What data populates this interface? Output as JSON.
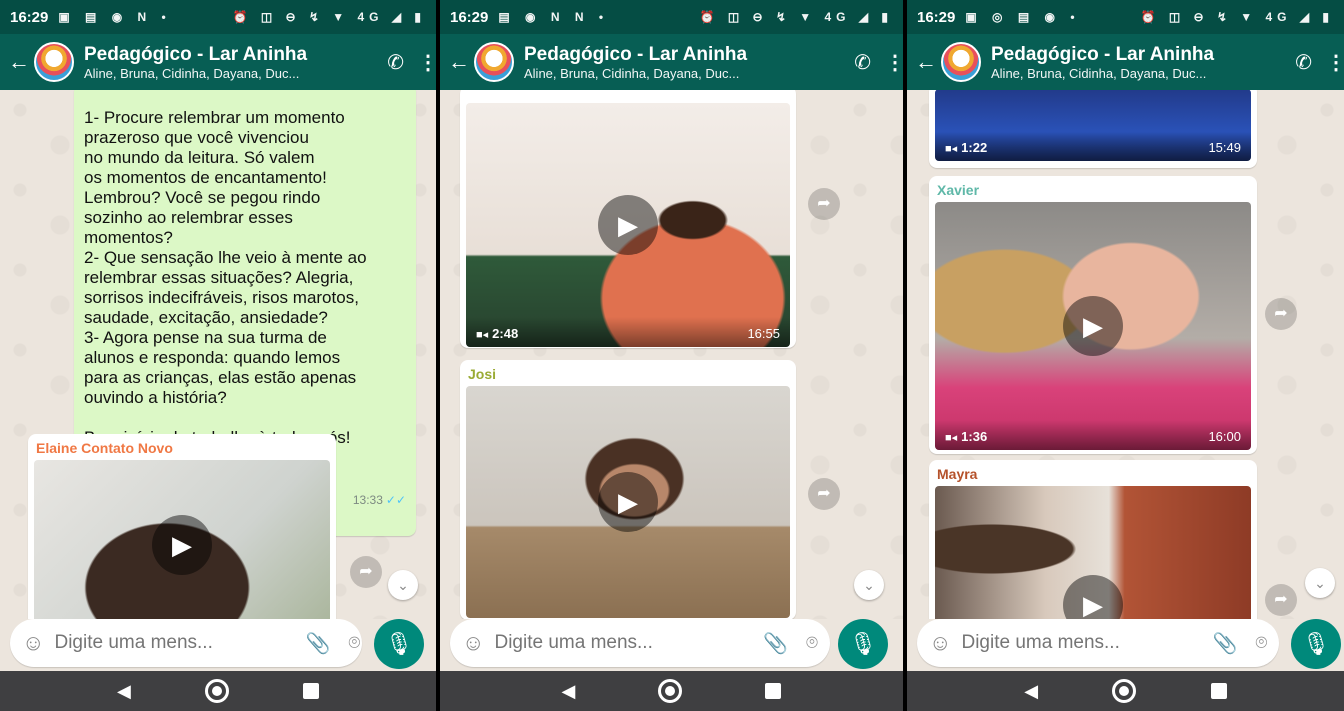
{
  "colors": {
    "statusbar": "#054d44",
    "appbar": "#075e54",
    "outgoing_bubble": "#dcf8c6",
    "mic": "#00897b"
  },
  "panels": [
    {
      "status": {
        "time": "16:29",
        "left_icons": "▣ ▤ ◉ N •",
        "right_icons": "⏰ ◫ ⊖ ↯ ▼ 4G ◢ ▮"
      },
      "chat": {
        "title": "Pedagógico - Lar Aninha",
        "members": "Aline, Bruna, Cidinha, Dayana, Duc...",
        "outgoing_text": "1- Procure relembrar um momento\nprazeroso que você vivenciou\nno mundo da leitura. Só valem\nos momentos de encantamento!\nLembrou? Você se pegou rindo\nsozinho ao relembrar esses\nmomentos?\n2- Que sensação lhe veio à mente ao\nrelembrar essas situações? Alegria,\nsorrisos indecifráveis, risos marotos,\nsaudade, excitação, ansiedade?\n3- Agora pense na sua turma de\nalunos e responda: quando lemos\npara as crianças, elas estão apenas\nouvindo a história?\n\nBom início de trabalho à todas nós!",
        "outgoing_time": "13:33",
        "videos": [
          {
            "sender": "Elaine Contato Novo",
            "sender_color": "#f07844"
          }
        ]
      },
      "input": {
        "placeholder": "Digite uma mens..."
      }
    },
    {
      "status": {
        "time": "16:29",
        "left_icons": "▤ ◉ N N •",
        "right_icons": "⏰ ◫ ⊖ ↯ ▼ 4G ◢ ▮"
      },
      "chat": {
        "title": "Pedagógico - Lar Aninha",
        "members": "Aline, Bruna, Cidinha, Dayana, Duc...",
        "videos": [
          {
            "sender": "",
            "duration": "2:48",
            "time": "16:55"
          },
          {
            "sender": "Josi",
            "sender_color": "#9aab34"
          }
        ]
      },
      "input": {
        "placeholder": "Digite uma mens..."
      }
    },
    {
      "status": {
        "time": "16:29",
        "left_icons": "▣ ◎ ▤ ◉ •",
        "right_icons": "⏰ ◫ ⊖ ↯ ▼ 4G ◢ ▮"
      },
      "chat": {
        "title": "Pedagógico - Lar Aninha",
        "members": "Aline, Bruna, Cidinha, Dayana, Duc...",
        "videos": [
          {
            "sender": "",
            "duration": "1:22",
            "time": "15:49"
          },
          {
            "sender": "Xavier",
            "sender_color": "#5fb8a8",
            "duration": "1:36",
            "time": "16:00"
          },
          {
            "sender": "Mayra",
            "sender_color": "#b5522b"
          }
        ]
      },
      "input": {
        "placeholder": "Digite uma mens..."
      }
    }
  ]
}
